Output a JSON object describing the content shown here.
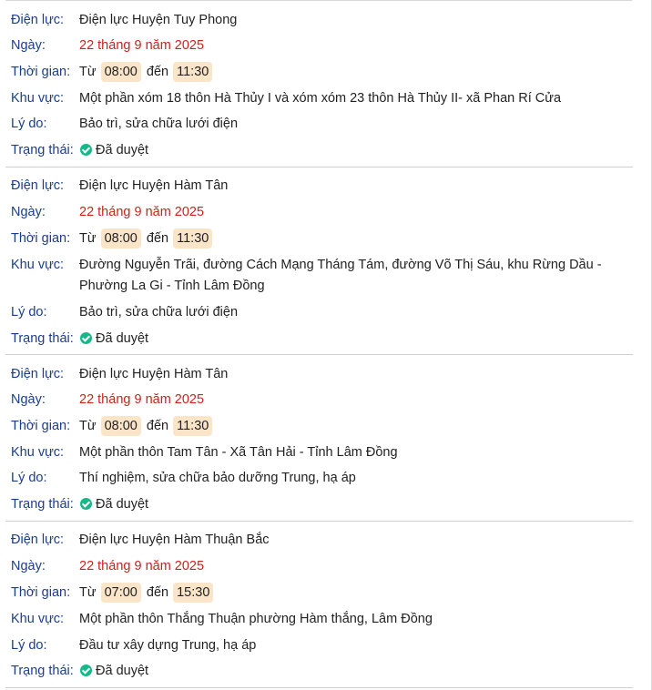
{
  "labels": {
    "power": "Điện lực:",
    "date": "Ngày:",
    "time": "Thời gian:",
    "area": "Khu vực:",
    "reason": "Lý do:",
    "status": "Trạng thái:",
    "from": "Từ",
    "to": "đến"
  },
  "records": [
    {
      "power": "Điện lực Huyện Tuy Phong",
      "date": "22 tháng 9 năm 2025",
      "start": "08:00",
      "end": "11:30",
      "area": "Một phần xóm 18 thôn Hà Thủy I và xóm xóm 23 thôn Hà Thủy II- xã Phan Rí Cửa",
      "reason": "Bảo trì, sửa chữa lưới điện",
      "status": "Đã duyệt"
    },
    {
      "power": "Điện lực Huyện Hàm Tân",
      "date": "22 tháng 9 năm 2025",
      "start": "08:00",
      "end": "11:30",
      "area": "Đường Nguyễn Trãi, đường Cách Mạng Tháng Tám, đường Võ Thị Sáu, khu Rừng Dầu - Phường La Gi - Tỉnh Lâm Đồng",
      "reason": "Bảo trì, sửa chữa lưới điện",
      "status": "Đã duyệt"
    },
    {
      "power": "Điện lực Huyện Hàm Tân",
      "date": "22 tháng 9 năm 2025",
      "start": "08:00",
      "end": "11:30",
      "area": "Một phần thôn Tam Tân - Xã Tân Hải - Tỉnh Lâm Đồng",
      "reason": "Thí nghiệm, sửa chữa bảo dưỡng Trung, hạ áp",
      "status": "Đã duyệt"
    },
    {
      "power": "Điện lực Huyện Hàm Thuận Bắc",
      "date": "22 tháng 9 năm 2025",
      "start": "07:00",
      "end": "15:30",
      "area": "Một phần thôn Thắng Thuận phường Hàm thắng, Lâm Đồng",
      "reason": "Đầu tư xây dựng Trung, hạ áp",
      "status": "Đã duyệt"
    }
  ],
  "colors": {
    "label": "#1a3d8f",
    "date": "#d0201b",
    "chip": "#fbe5c9",
    "status_icon": "#16b88a"
  },
  "icons": {
    "status": "check-circle-icon"
  }
}
